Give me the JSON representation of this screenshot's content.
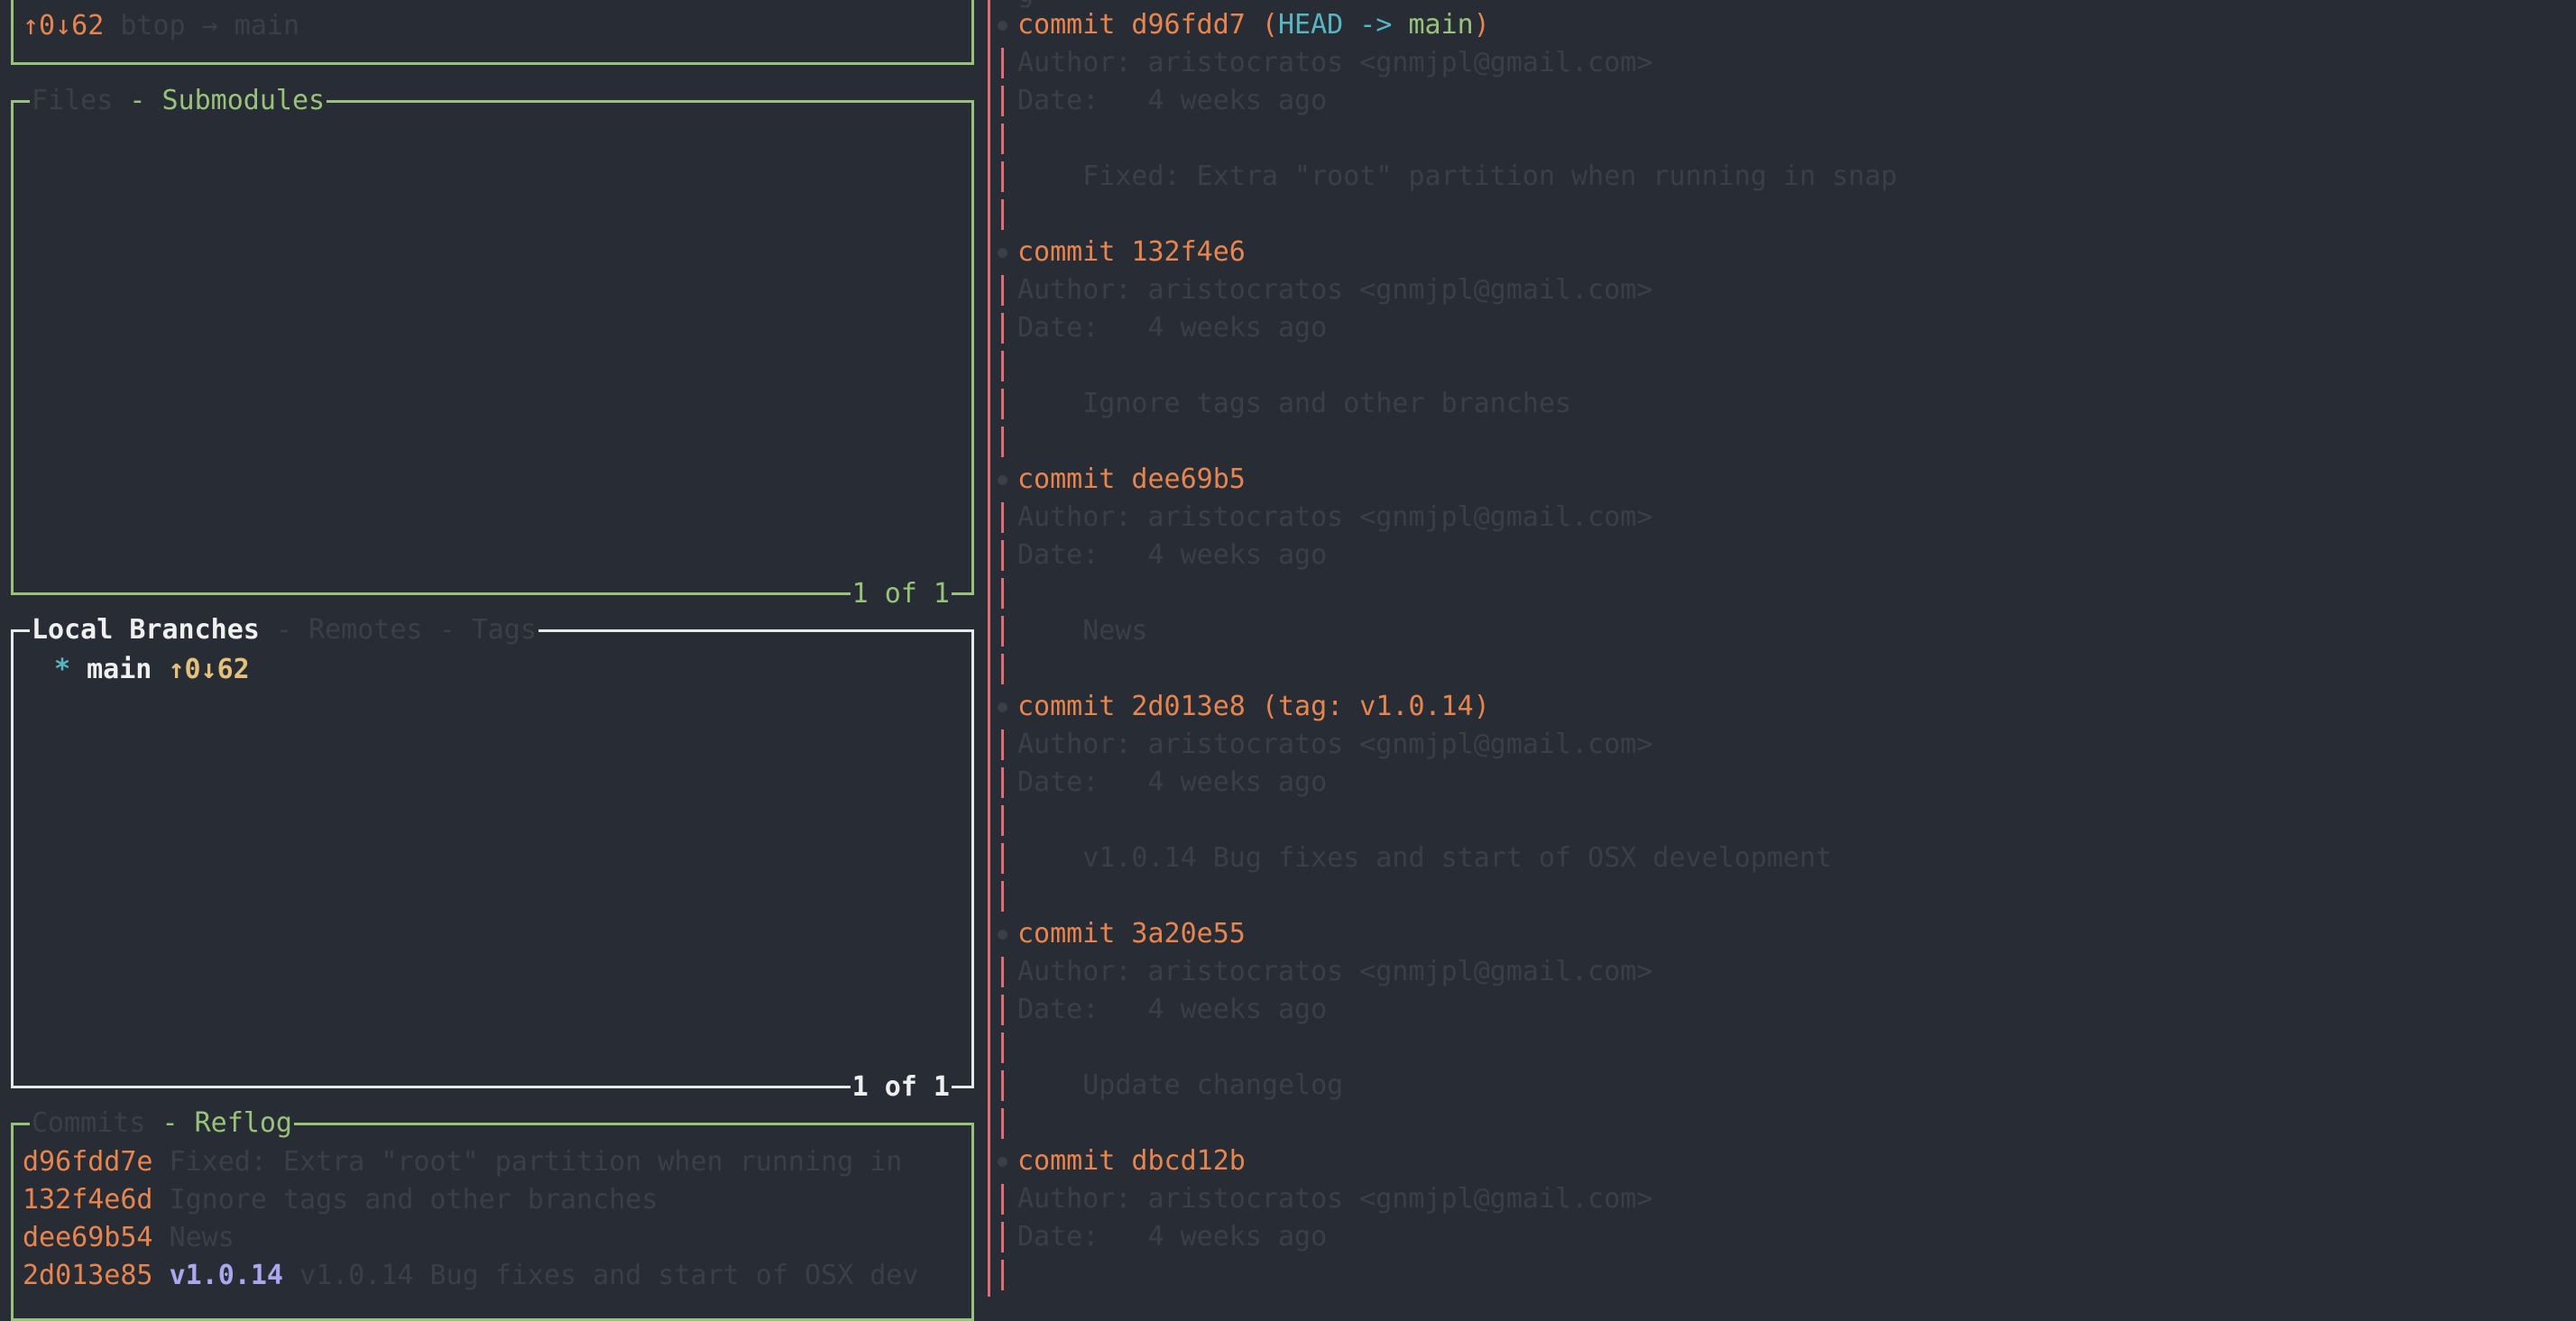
{
  "status": {
    "arrows": "↑0↓62",
    "repo": "btop → main"
  },
  "files_panel": {
    "tab_files": "Files",
    "separator": "-",
    "tab_submodules": "Submodules",
    "footer": "1 of 1"
  },
  "branches_panel": {
    "tab_local": "Local Branches",
    "sep1": "-",
    "tab_remotes": "Remotes",
    "sep2": "-",
    "tab_tags": "Tags",
    "footer": "1 of 1",
    "items": [
      {
        "marker": "*",
        "name": "main",
        "arrows": "↑0↓62"
      }
    ]
  },
  "commits_panel": {
    "tab_commits": "Commits",
    "separator": "-",
    "tab_reflog": "Reflog",
    "rows": [
      {
        "hash": "d96fdd7e",
        "tag": "",
        "message": "Fixed: Extra \"root\" partition when running in"
      },
      {
        "hash": "132f4e6d",
        "tag": "",
        "message": "Ignore tags and other branches"
      },
      {
        "hash": "dee69b54",
        "tag": "",
        "message": "News"
      },
      {
        "hash": "2d013e85",
        "tag": "v1.0.14",
        "message": "v1.0.14 Bug fixes and start of OSX dev"
      }
    ]
  },
  "log": {
    "top_fragment": "g",
    "commits": [
      {
        "label": "commit d96fdd7",
        "refs_open": " (",
        "head": "HEAD ->",
        "branch": " main",
        "refs_close": ")",
        "author": "Author: aristocratos <gnmjpl@gmail.com>",
        "date": "Date:   4 weeks ago",
        "message": "    Fixed: Extra \"root\" partition when running in snap"
      },
      {
        "label": "commit 132f4e6",
        "author": "Author: aristocratos <gnmjpl@gmail.com>",
        "date": "Date:   4 weeks ago",
        "message": "    Ignore tags and other branches"
      },
      {
        "label": "commit dee69b5",
        "author": "Author: aristocratos <gnmjpl@gmail.com>",
        "date": "Date:   4 weeks ago",
        "message": "    News"
      },
      {
        "label": "commit 2d013e8 (tag: v1.0.14)",
        "author": "Author: aristocratos <gnmjpl@gmail.com>",
        "date": "Date:   4 weeks ago",
        "message": "    v1.0.14 Bug fixes and start of OSX development"
      },
      {
        "label": "commit 3a20e55",
        "author": "Author: aristocratos <gnmjpl@gmail.com>",
        "date": "Date:   4 weeks ago",
        "message": "    Update changelog"
      },
      {
        "label": "commit dbcd12b",
        "author": "Author: aristocratos <gnmjpl@gmail.com>",
        "date": "Date:   4 weeks ago",
        "message": ""
      }
    ]
  }
}
